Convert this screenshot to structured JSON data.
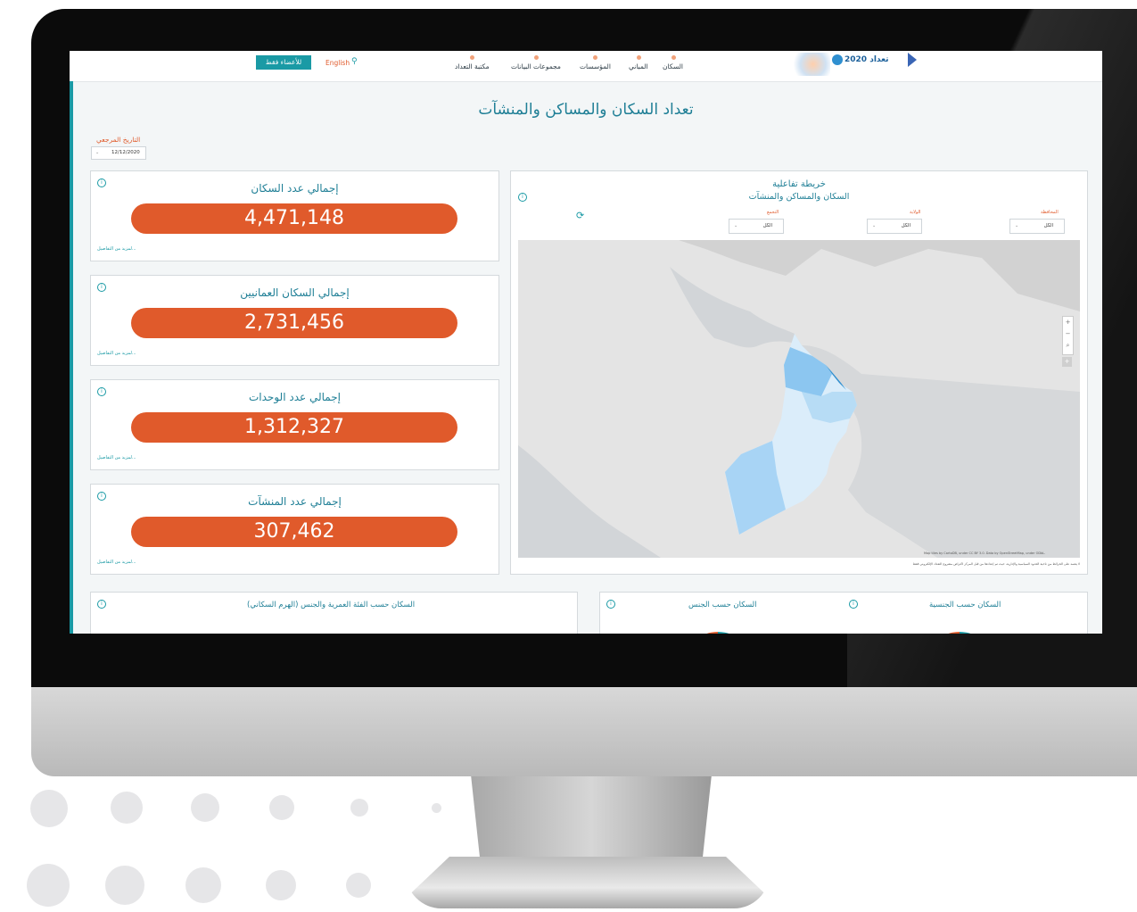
{
  "nav": {
    "items": [
      "السكان",
      "المباني",
      "المؤسسات",
      "مجموعات البيانات",
      "مكتبة التعداد"
    ],
    "language_link": "English",
    "members_button": "للأعضاء فقط",
    "logo_text": "تعداد 2020"
  },
  "page": {
    "title": "تعداد السكان والمساكن والمنشآت",
    "reference_date_label": "التاريخ المرجعي",
    "reference_date_value": "12/12/2020"
  },
  "stat_cards": [
    {
      "title": "إجمالي عدد السكان",
      "value": "4,471,148",
      "more_link": "لمزيد من التفاصيل..."
    },
    {
      "title": "إجمالي السكان العمانيين",
      "value": "2,731,456",
      "more_link": "لمزيد من التفاصيل..."
    },
    {
      "title": "إجمالي عدد الوحدات",
      "value": "1,312,327",
      "more_link": "لمزيد من التفاصيل..."
    },
    {
      "title": "إجمالي عدد المنشآت",
      "value": "307,462",
      "more_link": "لمزيد من التفاصيل..."
    }
  ],
  "map": {
    "title": "خريطة تفاعلية",
    "subtitle": "السكان والمساكن والمنشآت",
    "filters": [
      {
        "label": "المحافظة",
        "value": "الكل"
      },
      {
        "label": "الولاية",
        "value": "الكل"
      },
      {
        "label": "التجمع",
        "value": "الكل"
      }
    ],
    "attribution": "Map tiles by CartoDB, under CC BY 3.0. Data by OpenStreetMap, under ODbL.",
    "disclaimer": "لا يعتمد على الخرائط من ناحية الحدود السياسية والإدارية، حيث تم إعدادها من قبل المركز لأغراض مشروع التعداد الإلكتروني فقط"
  },
  "bottom_panels": {
    "pyramid_title": "السكان حسب الفئة العمرية والجنس (الهرم السكاني)",
    "gender_title": "السكان حسب الجنس",
    "nationality_title": "السكان حسب الجنسية"
  },
  "colors": {
    "accent_orange": "#e05a2b",
    "accent_teal": "#1a9aa5",
    "title_teal": "#1f7f96"
  }
}
